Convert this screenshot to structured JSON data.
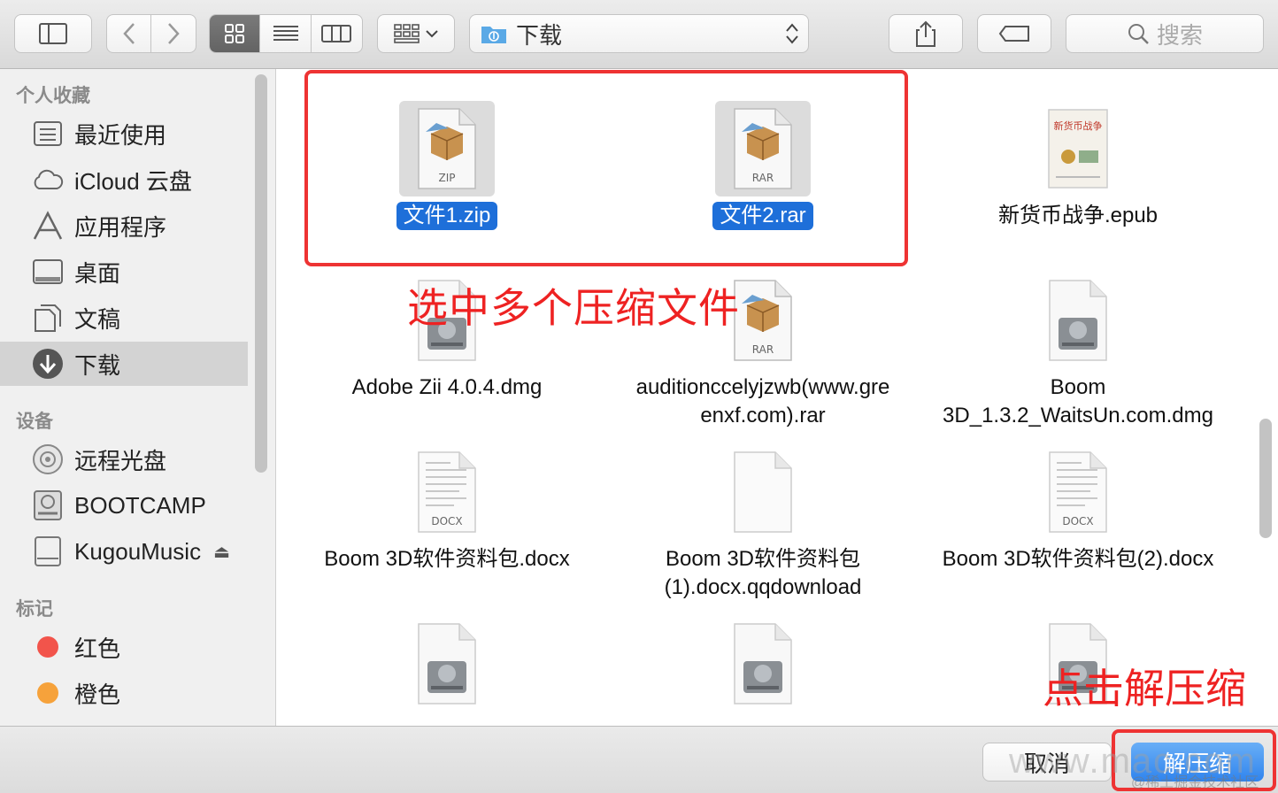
{
  "toolbar": {
    "path_label": "下载",
    "search_placeholder": "搜索"
  },
  "sidebar": {
    "favorites_title": "个人收藏",
    "favorites": [
      {
        "label": "最近使用",
        "icon": "recents-icon"
      },
      {
        "label": "iCloud 云盘",
        "icon": "icloud-icon"
      },
      {
        "label": "应用程序",
        "icon": "applications-icon"
      },
      {
        "label": "桌面",
        "icon": "desktop-icon"
      },
      {
        "label": "文稿",
        "icon": "documents-icon"
      },
      {
        "label": "下载",
        "icon": "downloads-icon",
        "selected": true
      }
    ],
    "devices_title": "设备",
    "devices": [
      {
        "label": "远程光盘",
        "icon": "remote-disc-icon"
      },
      {
        "label": "BOOTCAMP",
        "icon": "disk-icon"
      },
      {
        "label": "KugouMusic",
        "icon": "external-drive-icon",
        "ejectable": true
      }
    ],
    "tags_title": "标记",
    "tags": [
      {
        "label": "红色",
        "color": "#f2544b"
      },
      {
        "label": "橙色",
        "color": "#f6a23b"
      }
    ]
  },
  "files": [
    {
      "name": "文件1.zip",
      "badge": "ZIP",
      "type": "archive",
      "selected": true
    },
    {
      "name": "文件2.rar",
      "badge": "RAR",
      "type": "archive",
      "selected": true
    },
    {
      "name": "新货币战争.epub",
      "type": "book",
      "cover_title": "新货币战争"
    },
    {
      "name": "Adobe Zii 4.0.4.dmg",
      "type": "dmg"
    },
    {
      "name": "auditionccelyjzwb(www.gre enxf.com).rar",
      "badge": "RAR",
      "type": "archive"
    },
    {
      "name": "Boom 3D_1.3.2_WaitsUn.com.dmg",
      "type": "dmg"
    },
    {
      "name": "Boom 3D软件资料包.docx",
      "badge": "DOCX",
      "type": "docx"
    },
    {
      "name": "Boom 3D软件资料包 (1).docx.qqdownload",
      "type": "blank"
    },
    {
      "name": "Boom 3D软件资料包(2).docx",
      "badge": "DOCX",
      "type": "docx"
    },
    {
      "name": "",
      "type": "dmg"
    },
    {
      "name": "",
      "type": "dmg"
    },
    {
      "name": "",
      "type": "dmg"
    }
  ],
  "annotations": {
    "select_note": "选中多个压缩文件",
    "click_note": "点击解压缩"
  },
  "buttons": {
    "cancel": "取消",
    "extract": "解压缩"
  },
  "watermark": {
    "text": "www.mac.com",
    "sub": "@稀土掘金技术社区"
  },
  "colors": {
    "selection_blue": "#1e6fd9",
    "annotation_red": "#ee3333",
    "primary_button": "#2f84ee"
  }
}
